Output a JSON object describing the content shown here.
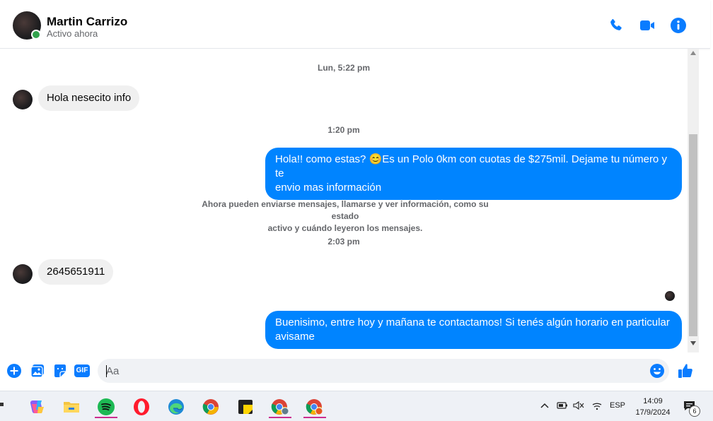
{
  "header": {
    "name": "Martin Carrizo",
    "status": "Activo ahora",
    "icons": [
      "phone-icon",
      "video-camera-icon",
      "info-icon"
    ]
  },
  "conversation": {
    "timestamps": [
      "Lun, 5:22 pm",
      "1:20 pm",
      "2:03 pm"
    ],
    "messages": [
      {
        "from": "contact",
        "text": "Hola nesecito info"
      },
      {
        "from": "me",
        "line1": "Hola!! como estas? 😊Es un Polo 0km con cuotas de $275mil. Dejame tu número y te",
        "line2": "envio mas información"
      },
      {
        "from": "contact",
        "text": "2645651911"
      },
      {
        "from": "me",
        "line1": "Buenisimo, entre hoy y mañana te contactamos! Si tenés algún horario en particular",
        "line2": "avisame"
      }
    ],
    "system": {
      "line1": "Ahora pueden enviarse mensajes, llamarse y ver información, como su estado",
      "line2": "activo y cuándo leyeron los mensajes."
    }
  },
  "composer": {
    "placeholder": "Aa",
    "gif_label": "GIF",
    "icons": [
      "plus-icon",
      "photo-icon",
      "sticker-icon",
      "gif-icon",
      "emoji-icon",
      "thumbs-up-icon"
    ]
  },
  "taskbar": {
    "apps": [
      "copilot-icon",
      "file-explorer-icon",
      "spotify-icon",
      "opera-icon",
      "edge-icon",
      "chrome-icon",
      "sticky-notes-icon",
      "chrome-profile-icon",
      "chrome-profile-2-icon"
    ],
    "language": "ESP",
    "time": "14:09",
    "date": "17/9/2024",
    "notifications_count": "6"
  },
  "colors": {
    "accent": "#0084ff",
    "incoming_bubble": "#f0f0f0",
    "online": "#31a24c",
    "icon_blue": "#0a7cff"
  }
}
